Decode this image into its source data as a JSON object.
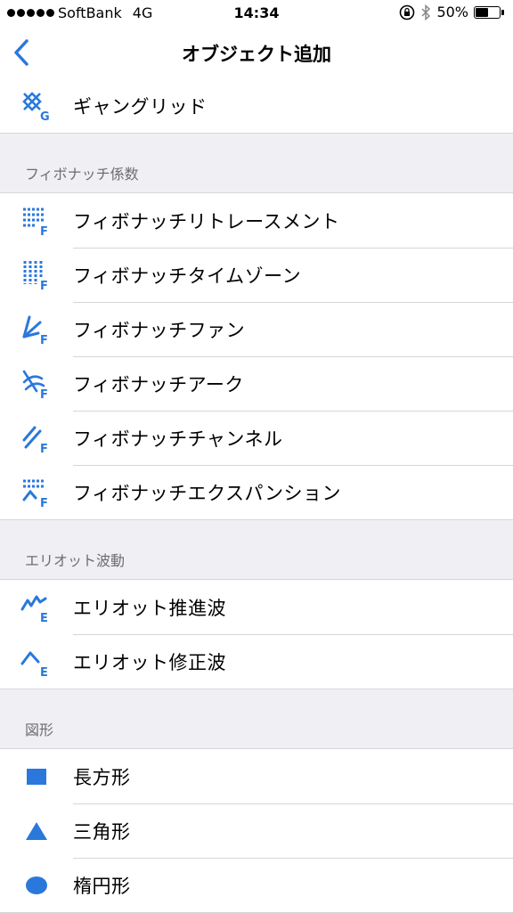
{
  "status_bar": {
    "carrier": "SoftBank",
    "network": "4G",
    "time": "14:34",
    "battery_percent": "50%",
    "battery_level": 0.5
  },
  "nav": {
    "title": "オブジェクト追加",
    "back_icon": "chevron-left-icon"
  },
  "colors": {
    "accent": "#2a78dc",
    "separator": "#d6d6da",
    "background": "#efeff4",
    "section_text": "#6d6d72"
  },
  "top_items": [
    {
      "label": "ギャングリッド",
      "icon": "gann-grid-icon"
    }
  ],
  "sections": [
    {
      "title": "フィボナッチ係数",
      "items": [
        {
          "label": "フィボナッチリトレースメント",
          "icon": "fibonacci-retracement-icon"
        },
        {
          "label": "フィボナッチタイムゾーン",
          "icon": "fibonacci-time-zone-icon"
        },
        {
          "label": "フィボナッチファン",
          "icon": "fibonacci-fan-icon"
        },
        {
          "label": "フィボナッチアーク",
          "icon": "fibonacci-arc-icon"
        },
        {
          "label": "フィボナッチチャンネル",
          "icon": "fibonacci-channel-icon"
        },
        {
          "label": "フィボナッチエクスパンション",
          "icon": "fibonacci-expansion-icon"
        }
      ]
    },
    {
      "title": "エリオット波動",
      "items": [
        {
          "label": "エリオット推進波",
          "icon": "elliott-impulse-wave-icon"
        },
        {
          "label": "エリオット修正波",
          "icon": "elliott-correction-wave-icon"
        }
      ]
    },
    {
      "title": "図形",
      "items": [
        {
          "label": "長方形",
          "icon": "rectangle-icon"
        },
        {
          "label": "三角形",
          "icon": "triangle-icon"
        },
        {
          "label": "楕円形",
          "icon": "ellipse-icon"
        }
      ]
    }
  ]
}
